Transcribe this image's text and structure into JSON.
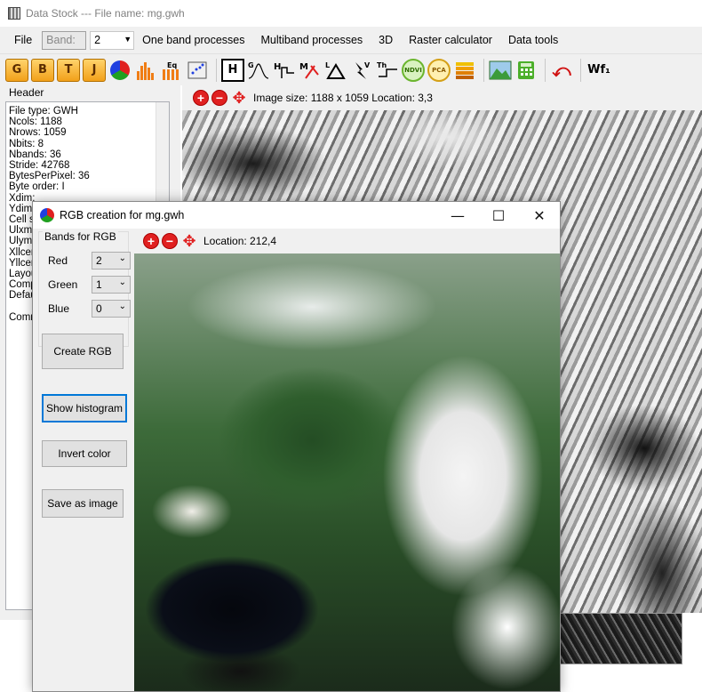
{
  "window": {
    "title": "Data Stock  ---  File name: mg.gwh"
  },
  "menubar": {
    "file": "File",
    "band_label": "Band:",
    "band_value": "2",
    "items": [
      "One band processes",
      "Multiband processes",
      "3D",
      "Raster calculator",
      "Data tools"
    ]
  },
  "toolbar": {
    "g": "G",
    "b": "B",
    "t": "T",
    "j": "J",
    "ndvi": "NDVI",
    "pca": "PCA",
    "wf": "Wf₁",
    "h": "H"
  },
  "header_panel": {
    "label": "Header",
    "lines": [
      "File type: GWH",
      "Ncols: 1188",
      "Nrows: 1059",
      "Nbits: 8",
      "Nbands: 36",
      "Stride: 42768",
      "BytesPerPixel: 36",
      "Byte order: I",
      "Xdim:",
      "Ydim:",
      "Cell s",
      "Ulxma",
      "Ulyma",
      "Xllcen",
      "Yllcen",
      "Layou",
      "Comp",
      "Defau",
      "",
      "Comm"
    ]
  },
  "main_image": {
    "info": "Image size: 1188 x 1059   Location: 3,3"
  },
  "dialog": {
    "title": "RGB creation for mg.gwh",
    "group_title": "Bands for RGB",
    "red_label": "Red",
    "red_value": "2",
    "green_label": "Green",
    "green_value": "1",
    "blue_label": "Blue",
    "blue_value": "0",
    "create_rgb": "Create RGB",
    "show_histogram": "Show histogram",
    "invert_color": "Invert color",
    "save_as_image": "Save as image",
    "location": "Location: 212,4"
  }
}
